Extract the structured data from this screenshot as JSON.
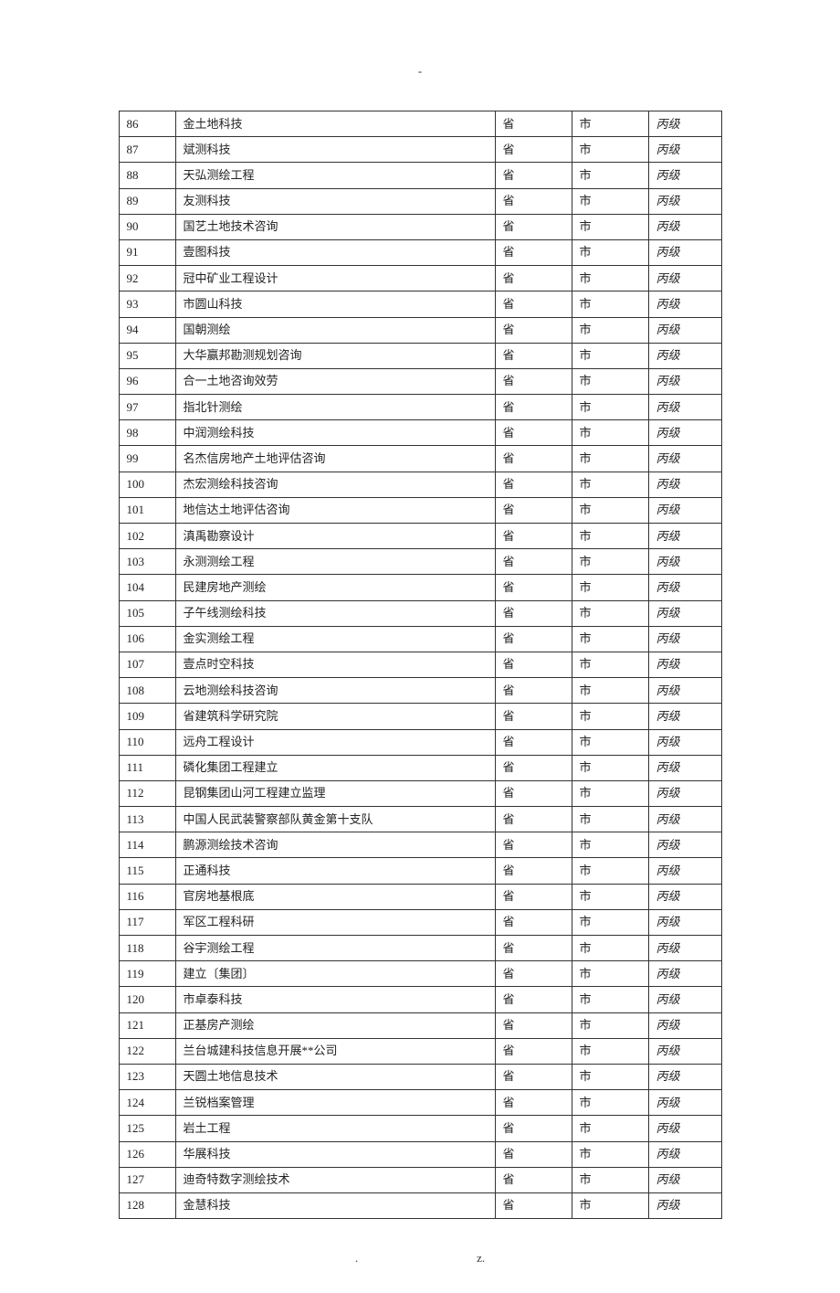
{
  "top_mark": "-",
  "footer_left": ".",
  "footer_right": "z.",
  "rows": [
    {
      "num": "86",
      "name": "金土地科技",
      "prov": "省",
      "city": "市",
      "grade": "丙级"
    },
    {
      "num": "87",
      "name": "斌测科技",
      "prov": "省",
      "city": "市",
      "grade": "丙级"
    },
    {
      "num": "88",
      "name": "天弘测绘工程",
      "prov": "省",
      "city": "市",
      "grade": "丙级"
    },
    {
      "num": "89",
      "name": "友测科技",
      "prov": "省",
      "city": "市",
      "grade": "丙级"
    },
    {
      "num": "90",
      "name": "国艺土地技术咨询",
      "prov": "省",
      "city": "市",
      "grade": "丙级"
    },
    {
      "num": "91",
      "name": "壹图科技",
      "prov": "省",
      "city": "市",
      "grade": "丙级"
    },
    {
      "num": "92",
      "name": "冠中矿业工程设计",
      "prov": "省",
      "city": "市",
      "grade": "丙级"
    },
    {
      "num": "93",
      "name": "市圆山科技",
      "prov": "省",
      "city": "市",
      "grade": "丙级"
    },
    {
      "num": "94",
      "name": "国朝测绘",
      "prov": "省",
      "city": "市",
      "grade": "丙级"
    },
    {
      "num": "95",
      "name": "大华赢邦勘测规划咨询",
      "prov": "省",
      "city": "市",
      "grade": "丙级"
    },
    {
      "num": "96",
      "name": "合一土地咨询效劳",
      "prov": "省",
      "city": "市",
      "grade": "丙级"
    },
    {
      "num": "97",
      "name": "指北针测绘",
      "prov": "省",
      "city": "市",
      "grade": "丙级"
    },
    {
      "num": "98",
      "name": "中润测绘科技",
      "prov": "省",
      "city": "市",
      "grade": "丙级"
    },
    {
      "num": "99",
      "name": "名杰信房地产土地评估咨询",
      "prov": "省",
      "city": "市",
      "grade": "丙级"
    },
    {
      "num": "100",
      "name": "杰宏测绘科技咨询",
      "prov": "省",
      "city": "市",
      "grade": "丙级"
    },
    {
      "num": "101",
      "name": "地信达土地评估咨询",
      "prov": "省",
      "city": "市",
      "grade": "丙级"
    },
    {
      "num": "102",
      "name": "滇禹勘察设计",
      "prov": "省",
      "city": "市",
      "grade": "丙级"
    },
    {
      "num": "103",
      "name": "永测测绘工程",
      "prov": "省",
      "city": "市",
      "grade": "丙级"
    },
    {
      "num": "104",
      "name": "民建房地产测绘",
      "prov": "省",
      "city": "市",
      "grade": "丙级"
    },
    {
      "num": "105",
      "name": "子午线测绘科技",
      "prov": "省",
      "city": "市",
      "grade": "丙级"
    },
    {
      "num": "106",
      "name": "金实测绘工程",
      "prov": "省",
      "city": "市",
      "grade": "丙级"
    },
    {
      "num": "107",
      "name": "壹点时空科技",
      "prov": "省",
      "city": "市",
      "grade": "丙级"
    },
    {
      "num": "108",
      "name": "云地测绘科技咨询",
      "prov": "省",
      "city": "市",
      "grade": "丙级"
    },
    {
      "num": "109",
      "name": "省建筑科学研究院",
      "prov": "省",
      "city": "市",
      "grade": "丙级"
    },
    {
      "num": "110",
      "name": "远舟工程设计",
      "prov": "省",
      "city": "市",
      "grade": "丙级"
    },
    {
      "num": "111",
      "name": "磷化集团工程建立",
      "prov": "省",
      "city": "市",
      "grade": "丙级"
    },
    {
      "num": "112",
      "name": "昆钢集团山河工程建立监理",
      "prov": "省",
      "city": "市",
      "grade": "丙级"
    },
    {
      "num": "113",
      "name": "中国人民武装警察部队黄金第十支队",
      "prov": "省",
      "city": "市",
      "grade": "丙级"
    },
    {
      "num": "114",
      "name": "鹏源测绘技术咨询",
      "prov": "省",
      "city": "市",
      "grade": "丙级"
    },
    {
      "num": "115",
      "name": "正通科技",
      "prov": "省",
      "city": "市",
      "grade": "丙级"
    },
    {
      "num": "116",
      "name": "官房地基根底",
      "prov": "省",
      "city": "市",
      "grade": "丙级"
    },
    {
      "num": "117",
      "name": "军区工程科研",
      "prov": "省",
      "city": "市",
      "grade": "丙级"
    },
    {
      "num": "118",
      "name": "谷宇测绘工程",
      "prov": "省",
      "city": "市",
      "grade": "丙级"
    },
    {
      "num": "119",
      "name": "建立〔集团〕",
      "prov": "省",
      "city": "市",
      "grade": "丙级"
    },
    {
      "num": "120",
      "name": "市卓泰科技",
      "prov": "省",
      "city": "市",
      "grade": "丙级"
    },
    {
      "num": "121",
      "name": "正基房产测绘",
      "prov": "省",
      "city": "市",
      "grade": "丙级"
    },
    {
      "num": "122",
      "name": "兰台城建科技信息开展**公司",
      "prov": "省",
      "city": "市",
      "grade": "丙级"
    },
    {
      "num": "123",
      "name": "天圆土地信息技术",
      "prov": "省",
      "city": "市",
      "grade": "丙级"
    },
    {
      "num": "124",
      "name": "兰锐档案管理",
      "prov": "省",
      "city": "市",
      "grade": "丙级"
    },
    {
      "num": "125",
      "name": "岩土工程",
      "prov": "省",
      "city": "市",
      "grade": "丙级"
    },
    {
      "num": "126",
      "name": "华展科技",
      "prov": "省",
      "city": "市",
      "grade": "丙级"
    },
    {
      "num": "127",
      "name": "迪奇特数字测绘技术",
      "prov": "省",
      "city": "市",
      "grade": "丙级"
    },
    {
      "num": "128",
      "name": "金慧科技",
      "prov": "省",
      "city": "市",
      "grade": "丙级"
    }
  ]
}
